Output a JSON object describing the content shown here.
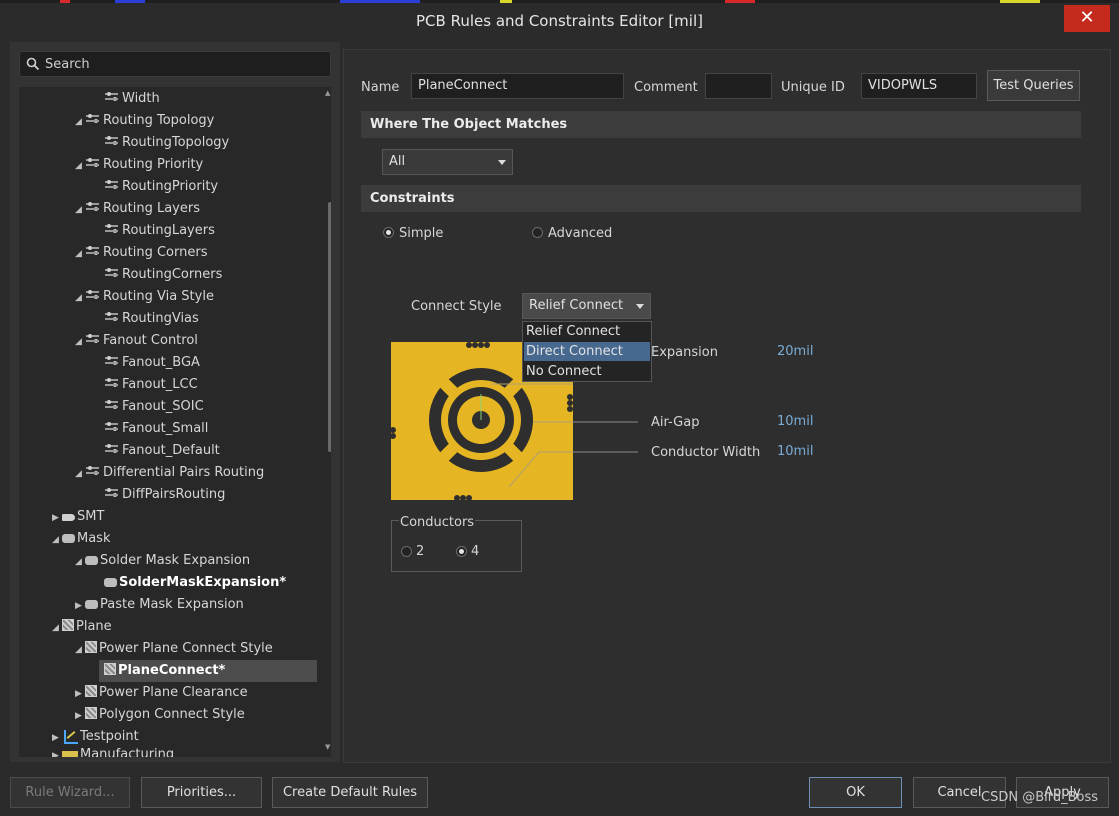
{
  "window": {
    "title": "PCB Rules and Constraints Editor [mil]",
    "close_glyph": "✕"
  },
  "search": {
    "placeholder": "Search"
  },
  "tree": {
    "items": [
      {
        "label": "Width",
        "icon": "rule-icon"
      },
      {
        "label": "Routing Topology",
        "icon": "rule-icon"
      },
      {
        "label": "RoutingTopology",
        "icon": "rule-icon"
      },
      {
        "label": "Routing Priority",
        "icon": "rule-icon"
      },
      {
        "label": "RoutingPriority",
        "icon": "rule-icon"
      },
      {
        "label": "Routing Layers",
        "icon": "rule-icon"
      },
      {
        "label": "RoutingLayers",
        "icon": "rule-icon"
      },
      {
        "label": "Routing Corners",
        "icon": "rule-icon"
      },
      {
        "label": "RoutingCorners",
        "icon": "rule-icon"
      },
      {
        "label": "Routing Via Style",
        "icon": "rule-icon"
      },
      {
        "label": "RoutingVias",
        "icon": "rule-icon"
      },
      {
        "label": "Fanout Control",
        "icon": "rule-icon"
      },
      {
        "label": "Fanout_BGA",
        "icon": "rule-icon"
      },
      {
        "label": "Fanout_LCC",
        "icon": "rule-icon"
      },
      {
        "label": "Fanout_SOIC",
        "icon": "rule-icon"
      },
      {
        "label": "Fanout_Small",
        "icon": "rule-icon"
      },
      {
        "label": "Fanout_Default",
        "icon": "rule-icon"
      },
      {
        "label": "Differential Pairs Routing",
        "icon": "rule-icon"
      },
      {
        "label": "DiffPairsRouting",
        "icon": "rule-icon"
      },
      {
        "label": "SMT",
        "icon": "smt-icon"
      },
      {
        "label": "Mask",
        "icon": "mask-icon"
      },
      {
        "label": "Solder Mask Expansion",
        "icon": "mask-icon"
      },
      {
        "label": "SolderMaskExpansion*",
        "icon": "mask-icon"
      },
      {
        "label": "Paste Mask Expansion",
        "icon": "mask-icon"
      },
      {
        "label": "Plane",
        "icon": "plane-icon"
      },
      {
        "label": "Power Plane Connect Style",
        "icon": "plane-icon"
      },
      {
        "label": "PlaneConnect*",
        "icon": "plane-icon"
      },
      {
        "label": "Power Plane Clearance",
        "icon": "plane-icon"
      },
      {
        "label": "Polygon Connect Style",
        "icon": "plane-icon"
      },
      {
        "label": "Testpoint",
        "icon": "testpoint-icon"
      },
      {
        "label": "Manufacturing",
        "icon": "manufacturing-icon"
      }
    ]
  },
  "rule": {
    "name_label": "Name",
    "name_value": "PlaneConnect",
    "comment_label": "Comment",
    "comment_value": "",
    "uid_label": "Unique ID",
    "uid_value": "VIDOPWLS",
    "test_queries": "Test Queries"
  },
  "where": {
    "heading": "Where The Object Matches",
    "scope_value": "All"
  },
  "constraints": {
    "heading": "Constraints",
    "mode_simple": "Simple",
    "mode_advanced": "Advanced",
    "mode_selected": "Simple",
    "connect_style_label": "Connect Style",
    "connect_style_value": "Relief Connect",
    "connect_style_options": [
      "Relief Connect",
      "Direct Connect",
      "No Connect"
    ],
    "highlighted_option": "Direct Connect",
    "expansion_label": "Expansion",
    "expansion_value": "20mil",
    "airgap_label": "Air-Gap",
    "airgap_value": "10mil",
    "conductor_width_label": "Conductor Width",
    "conductor_width_value": "10mil",
    "conductors_label": "Conductors",
    "conductors_options": [
      "2",
      "4"
    ],
    "conductors_selected": "4",
    "diagram_color": "#e5b523"
  },
  "footer": {
    "rule_wizard": "Rule Wizard...",
    "priorities": "Priorities...",
    "create_default": "Create Default Rules",
    "ok": "OK",
    "cancel": "Cancel",
    "apply": "Apply"
  },
  "watermark": "CSDN @Bird_Boss"
}
